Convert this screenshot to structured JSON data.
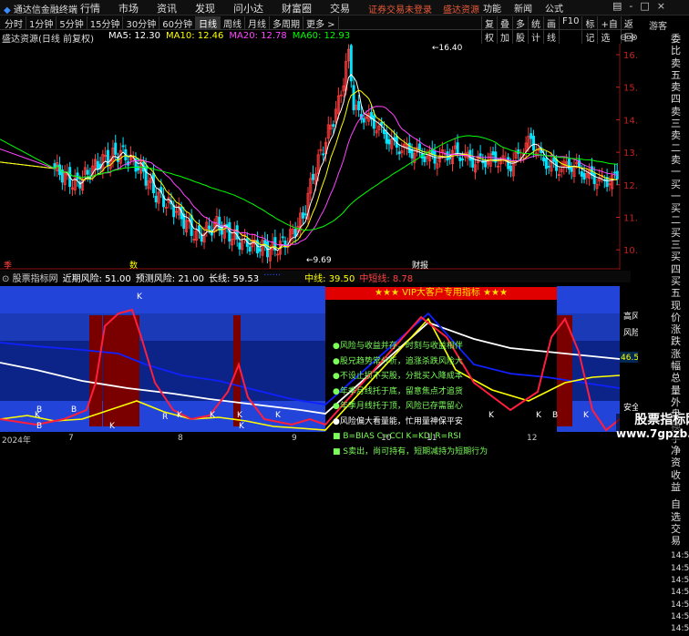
{
  "title_bar": {
    "brand": "通达信金融终端",
    "menu": [
      "行情",
      "市场",
      "资讯",
      "发现",
      "问小达",
      "财富圈",
      "交易"
    ],
    "alerts": [
      "证券交易未登录",
      "盛达资源"
    ],
    "right_menu": [
      "功能",
      "新闻",
      "公式"
    ],
    "window_controls": [
      "-",
      "□",
      "×"
    ]
  },
  "toolbar": {
    "periods": [
      "分时",
      "1分钟",
      "5分钟",
      "15分钟",
      "30分钟",
      "60分钟",
      "日线",
      "周线",
      "月线",
      "多周期",
      "更多 >"
    ],
    "active_period": "日线",
    "right_tools": [
      "复权",
      "叠加",
      "多股",
      "统计",
      "画线",
      "F10",
      "标记",
      "+自选",
      "返回"
    ],
    "guest": "游客"
  },
  "stock": {
    "name": "盛达资源(日线 前复权)",
    "ma": [
      {
        "label": "MA5: 12.30",
        "color": "#ffffff"
      },
      {
        "label": "MA10: 12.46",
        "color": "#ffff00"
      },
      {
        "label": "MA20: 12.78",
        "color": "#ff44ff"
      },
      {
        "label": "MA60: 12.93",
        "color": "#00ff00"
      }
    ],
    "price_ticks": [
      "16.00",
      "15.00",
      "14.00",
      "13.00",
      "12.00",
      "11.00",
      "10.00"
    ],
    "high_label": "16.40",
    "low_label": "9.69",
    "markers": [
      "季",
      "数",
      "财报"
    ]
  },
  "side_panel": [
    "委比",
    "卖五",
    "卖四",
    "卖三",
    "卖二",
    "卖一",
    "买一",
    "买二",
    "买三",
    "买四",
    "买五",
    "现价",
    "涨跌",
    "涨幅",
    "总量",
    "外盘",
    "换手",
    "净资",
    "收益",
    "自选",
    "交易"
  ],
  "indicator": {
    "header": [
      {
        "text": "股票指标网",
        "color": "#cccccc"
      },
      {
        "text": "近期风险: 51.00",
        "color": "#ffffff"
      },
      {
        "text": "预测风险: 21.00",
        "color": "#ffffff"
      },
      {
        "text": "长线: 59.53",
        "color": "#ffffff"
      },
      {
        "text": "中线: 39.50",
        "color": "#ffff00"
      },
      {
        "text": "中短线: 8.78",
        "color": "#ff4040"
      }
    ],
    "right_labels": [
      "高风",
      "风险",
      "安全"
    ],
    "value_tag": "46.51",
    "value_tag_prefix": "短期",
    "time_labels": [
      "14:50",
      "14:50",
      "14:50",
      "14:50",
      "14:50",
      "14:50",
      "14:50"
    ],
    "vip_title": "★★★ VIP大客户专用指标 ★★★",
    "vip_lines": [
      {
        "text": "●风险与收益并存，时刻与收益相伴",
        "color": "#7cff5a"
      },
      {
        "text": "●股兄趋势常分析，追涨杀跌风险大",
        "color": "#7cff5a"
      },
      {
        "text": "●不设止损不买股，分批买入降成本",
        "color": "#7cff5a"
      },
      {
        "text": "●年季月线托于底，留意焦点才追货",
        "color": "#7cff5a"
      },
      {
        "text": "●年季月线托于顶，风险已存需留心",
        "color": "#7cff5a"
      },
      {
        "text": "●风险偏大看量能，忙用量神保平安",
        "color": "#ffffff"
      },
      {
        "text": "■ B=BIAS   C=CCI   K=KDJ   R=RSI",
        "color": "#7cff5a"
      },
      {
        "text": "■ S卖出，尚可持有，短期减持为短期行为",
        "color": "#7cff5a"
      }
    ],
    "letters": [
      "K",
      "K",
      "B",
      "K",
      "K",
      "K",
      "K",
      "K",
      "B",
      "B",
      "R",
      "K",
      "B",
      "K",
      "K",
      "K",
      "K"
    ]
  },
  "dates": [
    "2024年",
    "7",
    "8",
    "9",
    "10",
    "11",
    "12"
  ],
  "watermark": [
    "股票指标网",
    "www.7gpzb.com"
  ]
}
